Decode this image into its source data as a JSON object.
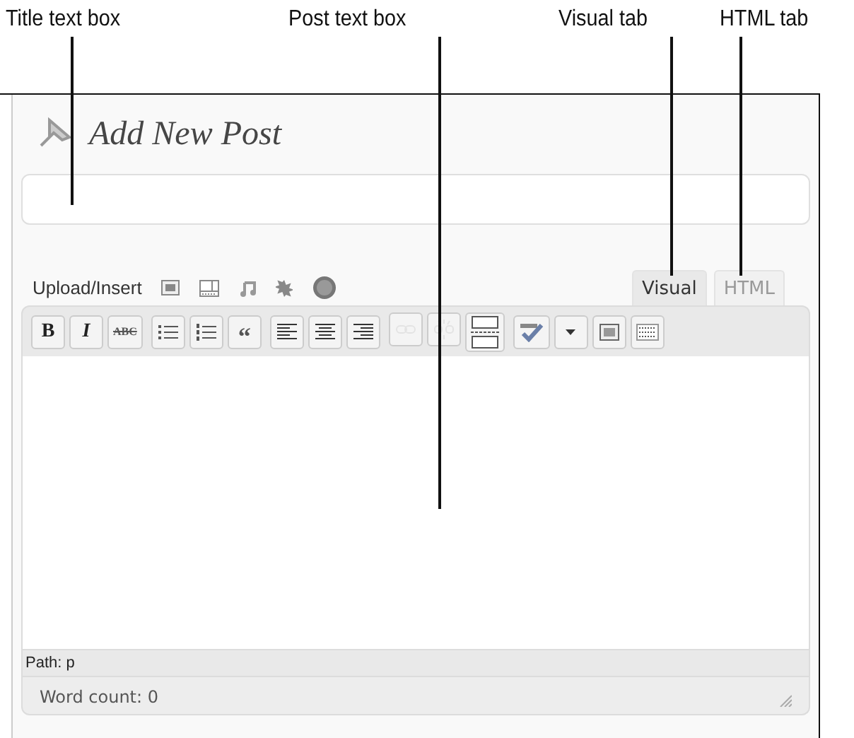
{
  "callouts": [
    {
      "label": "Title text box"
    },
    {
      "label": "Post text box"
    },
    {
      "label": "Visual tab"
    },
    {
      "label": "HTML tab"
    }
  ],
  "editor": {
    "heading": "Add New Post",
    "upload_label": "Upload/Insert",
    "media_buttons": [
      {
        "kind": "image"
      },
      {
        "kind": "video"
      },
      {
        "kind": "audio"
      },
      {
        "kind": "media"
      },
      {
        "kind": "circle"
      }
    ],
    "tabs": [
      {
        "label": "Visual",
        "selected": true
      },
      {
        "label": "HTML",
        "selected": false
      }
    ],
    "toolbar_groups": [
      [
        {
          "kind": "bold",
          "label": "B",
          "disabled": false
        },
        {
          "kind": "italic",
          "label": "I",
          "disabled": false
        },
        {
          "kind": "strike",
          "label": "ABC",
          "disabled": false
        }
      ],
      [
        {
          "kind": "bullets",
          "disabled": false
        },
        {
          "kind": "numbers",
          "disabled": false
        },
        {
          "kind": "quote",
          "label": "“",
          "disabled": false
        }
      ],
      [
        {
          "kind": "align-left",
          "disabled": false
        },
        {
          "kind": "align-center",
          "disabled": false
        },
        {
          "kind": "align-right",
          "disabled": false
        }
      ],
      [
        {
          "kind": "link",
          "disabled": true
        },
        {
          "kind": "unlink",
          "disabled": true
        },
        {
          "kind": "more",
          "disabled": false
        }
      ],
      [
        {
          "kind": "spell",
          "disabled": false
        },
        {
          "kind": "dropdown",
          "disabled": false
        },
        {
          "kind": "fullscreen",
          "disabled": false
        },
        {
          "kind": "kitchen-sink",
          "disabled": false
        }
      ]
    ],
    "path": "Path: p",
    "word_count": "Word count: 0"
  }
}
